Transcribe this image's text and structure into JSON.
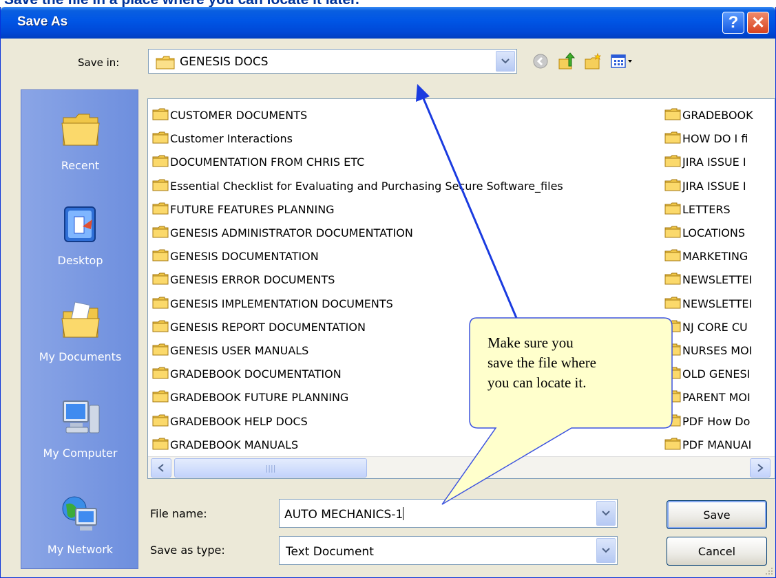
{
  "caption": "Save the file in a place where you can locate it later.",
  "dialog": {
    "title": "Save As",
    "help_glyph": "?",
    "close_glyph": "✕"
  },
  "save_in": {
    "label": "Save in:",
    "value": "GENESIS DOCS"
  },
  "places": [
    {
      "label": "Recent",
      "icon": "recent-folder-icon"
    },
    {
      "label": "Desktop",
      "icon": "desktop-icon"
    },
    {
      "label": "My Documents",
      "icon": "my-documents-icon"
    },
    {
      "label": "My Computer",
      "icon": "my-computer-icon"
    },
    {
      "label": "My Network",
      "icon": "my-network-icon"
    }
  ],
  "files_col1": [
    "CUSTOMER DOCUMENTS",
    "Customer Interactions",
    "DOCUMENTATION FROM CHRIS ETC",
    "Essential Checklist for Evaluating and Purchasing Secure Software_files",
    "FUTURE FEATURES PLANNING",
    "GENESIS ADMINISTRATOR DOCUMENTATION",
    "GENESIS DOCUMENTATION",
    "GENESIS ERROR DOCUMENTS",
    "GENESIS IMPLEMENTATION DOCUMENTS",
    "GENESIS REPORT DOCUMENTATION",
    "GENESIS USER MANUALS",
    "GRADEBOOK DOCUMENTATION",
    "GRADEBOOK FUTURE PLANNING",
    "GRADEBOOK HELP DOCS",
    "GRADEBOOK MANUALS"
  ],
  "files_col2": [
    "GRADEBOOK",
    "HOW DO I fi",
    "JIRA ISSUE I",
    "JIRA ISSUE I",
    "LETTERS",
    "LOCATIONS",
    "MARKETING",
    "NEWSLETTEI",
    "NEWSLETTEI",
    "NJ CORE CU",
    "NURSES MOI",
    "OLD GENESI",
    "PARENT MOI",
    "PDF How Do",
    "PDF MANUAI"
  ],
  "file_name": {
    "label": "File name:",
    "value": "AUTO MECHANICS-1"
  },
  "save_as_type": {
    "label": "Save as type:",
    "value": "Text Document"
  },
  "buttons": {
    "save": "Save",
    "cancel": "Cancel"
  },
  "callout": {
    "line1": "Make sure you",
    "line2": "save the file where",
    "line3": "you can locate it."
  },
  "colors": {
    "accent": "#0055e5",
    "callout_fill": "#ffffcc",
    "arrow": "#1a3be0"
  }
}
